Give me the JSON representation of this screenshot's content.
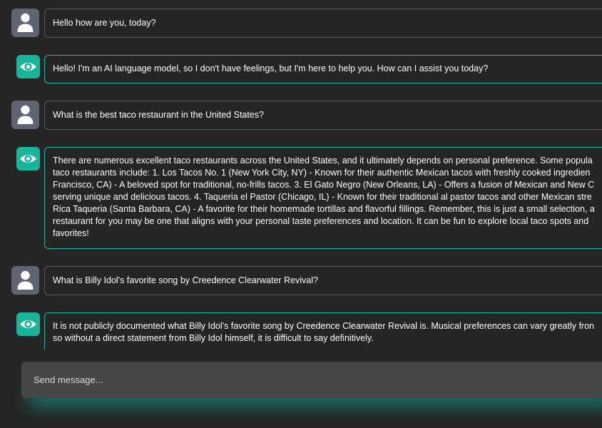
{
  "messages": [
    {
      "role": "user",
      "avatar_icon": "user-avatar-icon",
      "lines": [
        "Hello how are you, today?"
      ]
    },
    {
      "role": "assistant",
      "avatar_icon": "eye-icon",
      "lines": [
        "Hello! I'm an AI language model, so I don't have feelings, but I'm here to help you. How can I assist you today?"
      ]
    },
    {
      "role": "user",
      "avatar_icon": "user-avatar-icon",
      "lines": [
        "What is the best taco restaurant in the United States?"
      ]
    },
    {
      "role": "assistant",
      "avatar_icon": "eye-icon",
      "lines": [
        "There are numerous excellent taco restaurants across the United States, and it ultimately depends on personal preference. Some popula",
        "taco restaurants include: 1. Los Tacos No. 1 (New York City, NY) - Known for their authentic Mexican tacos with freshly cooked ingredien",
        "Francisco, CA) - A beloved spot for traditional, no-frills tacos. 3. El Gato Negro (New Orleans, LA) - Offers a fusion of Mexican and New C",
        "serving unique and delicious tacos. 4. Taqueria el Pastor (Chicago, IL) - Known for their traditional al pastor tacos and other Mexican stre",
        "Rica Taqueria (Santa Barbara, CA) - A favorite for their homemade tortillas and flavorful fillings. Remember, this is just a small selection, a",
        "restaurant for you may be one that aligns with your personal taste preferences and location. It can be fun to explore local taco spots and",
        "favorites!"
      ]
    },
    {
      "role": "user",
      "avatar_icon": "user-avatar-icon",
      "lines": [
        "What is Billy Idol's favorite song by Creedence Clearwater Revival?"
      ]
    },
    {
      "role": "assistant",
      "avatar_icon": "eye-icon",
      "lines": [
        "It is not publicly documented what Billy Idol's favorite song by Creedence Clearwater Revival is. Musical preferences can vary greatly fron",
        "so without a direct statement from Billy Idol himself, it is difficult to say definitively."
      ]
    }
  ],
  "composer": {
    "placeholder": "Send message...",
    "value": ""
  },
  "colors": {
    "background": "#252525",
    "accent": "#1ab99f",
    "user_avatar": "#5f6470",
    "user_border": "#5a5a5a",
    "composer_bg": "#474747"
  }
}
